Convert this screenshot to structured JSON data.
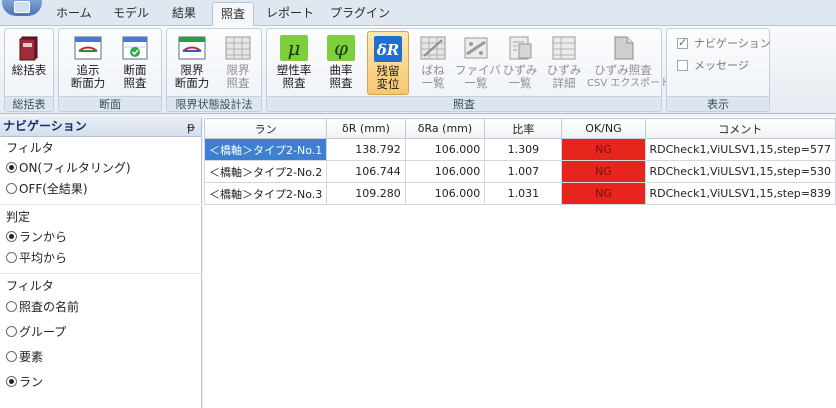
{
  "tabs": [
    "ホーム",
    "モデル",
    "結果",
    "照査",
    "レポート",
    "プラグイン"
  ],
  "active_tab": "照査",
  "ribbon": {
    "groups": {
      "summary": "総括表",
      "section": "断面",
      "limit": "限界状態設計法",
      "check": "照査",
      "display": "表示"
    },
    "buttons": {
      "summary": "総括表",
      "add_force_1": "追示",
      "add_force_2": "断面力",
      "sec_check_1": "断面",
      "sec_check_2": "照査",
      "limit_force_1": "限界",
      "limit_force_2": "断面力",
      "limit_check_1": "限界",
      "limit_check_2": "照査",
      "plastic_1": "塑性率",
      "plastic_2": "照査",
      "curv_1": "曲率",
      "curv_2": "照査",
      "resid_1": "残留",
      "resid_2": "変位",
      "spring_1": "ばね",
      "spring_2": "一覧",
      "fiber_1": "ファイバ",
      "fiber_2": "一覧",
      "strain_1": "ひずみ",
      "strain_2": "一覧",
      "strain_det_1": "ひずみ",
      "strain_det_2": "詳細",
      "csv_1": "ひずみ照査",
      "csv_2": "CSV エクスポート"
    },
    "icons": {
      "mu": "μ",
      "phi": "φ",
      "delta_r": "δR"
    },
    "display": {
      "navigation_label": "ナビゲーション",
      "navigation_checked": true,
      "message_label": "メッセージ",
      "message_checked": false
    }
  },
  "nav": {
    "title": "ナビゲーション",
    "pin": "ᵽ",
    "filter1_title": "フィルタ",
    "filter1_on": "ON(フィルタリング)",
    "filter1_off": "OFF(全結果)",
    "judge_title": "判定",
    "judge_run": "ランから",
    "judge_avg": "平均から",
    "filter2_title": "フィルタ",
    "filter2_name": "照査の名前",
    "filter2_group": "グループ",
    "filter2_element": "要素",
    "filter2_run": "ラン"
  },
  "grid": {
    "headers": [
      "ラン",
      "δR (mm)",
      "δRa (mm)",
      "比率",
      "OK/NG",
      "コメント"
    ],
    "rows": [
      [
        "＜橋軸＞タイプ2-No.1",
        "138.792",
        "106.000",
        "1.309",
        "NG",
        "RDCheck1,ViULSV1,15,step=577"
      ],
      [
        "＜橋軸＞タイプ2-No.2",
        "106.744",
        "106.000",
        "1.007",
        "NG",
        "RDCheck1,ViULSV1,15,step=530"
      ],
      [
        "＜橋軸＞タイプ2-No.3",
        "109.280",
        "106.000",
        "1.031",
        "NG",
        "RDCheck1,ViULSV1,15,step=839"
      ]
    ]
  },
  "colors": {
    "ng_fill": "#e7251d",
    "selection": "#3d7fd0",
    "active_button": "#f7c76f"
  }
}
